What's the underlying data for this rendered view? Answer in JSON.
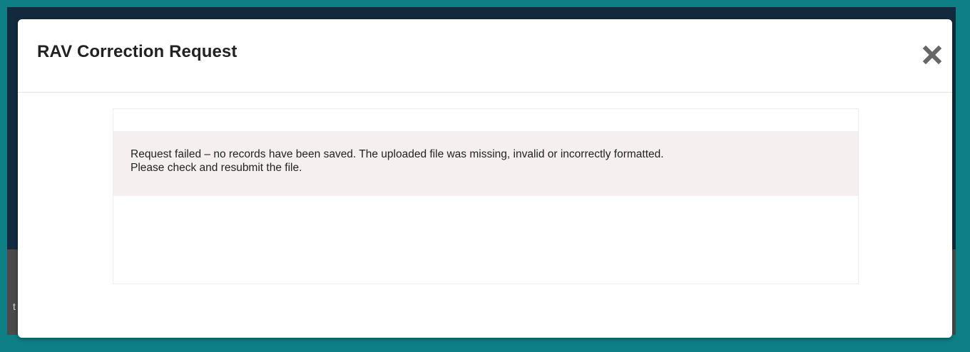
{
  "backdrop": {
    "partial_char": "t"
  },
  "modal": {
    "title": "RAV Correction Request",
    "close_icon": "close-icon"
  },
  "alert": {
    "message_line_1": "Request failed – no records have been saved. The uploaded file was missing, invalid or incorrectly formatted.",
    "message_line_2": "Please check and resubmit the file."
  },
  "colors": {
    "page_frame": "#0f7f86",
    "alert_background": "#f6efef",
    "close_icon": "#666666"
  }
}
